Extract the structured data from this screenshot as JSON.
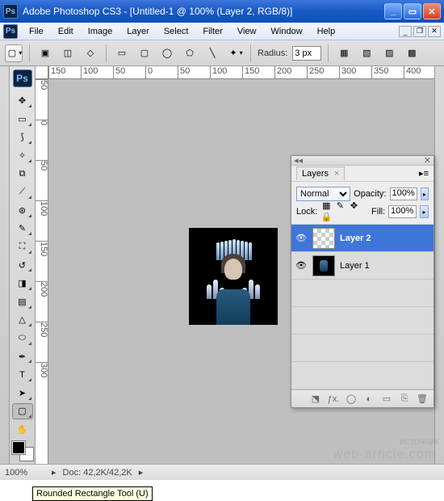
{
  "app": {
    "title": "Adobe Photoshop CS3 - [Untitled-1 @ 100% (Layer 2, RGB/8)]",
    "ps": "Ps"
  },
  "menu": {
    "file": "File",
    "edit": "Edit",
    "image": "Image",
    "layer": "Layer",
    "select": "Select",
    "filter": "Filter",
    "view": "View",
    "window": "Window",
    "help": "Help"
  },
  "options": {
    "radius_label": "Radius:",
    "radius_value": "3 px"
  },
  "ruler_h": [
    "150",
    "100",
    "50",
    "0",
    "50",
    "100",
    "150",
    "200",
    "250",
    "300",
    "350",
    "400"
  ],
  "ruler_v": [
    "5",
    "0",
    "0",
    "5",
    "0",
    "1",
    "0",
    "0",
    "1",
    "5",
    "0",
    "2",
    "0",
    "0",
    "2",
    "5",
    "0",
    "3",
    "0",
    "0"
  ],
  "layers_panel": {
    "title": "Layers",
    "blend": "Normal",
    "opacity_label": "Opacity:",
    "opacity": "100%",
    "lock_label": "Lock:",
    "fill_label": "Fill:",
    "fill": "100%",
    "layers": [
      {
        "name": "Layer 2",
        "selected": true,
        "thumb": "checker"
      },
      {
        "name": "Layer 1",
        "selected": false,
        "thumb": "dark"
      }
    ],
    "bottom_icons": [
      "⬔",
      "ƒx.",
      "◯",
      "◐",
      "▭",
      "⎘",
      "🗑"
    ]
  },
  "tooltip": "Rounded Rectangle Tool (U)",
  "status": {
    "zoom": "100%",
    "doc": "Doc: 42,2K/42,2K"
  },
  "watermark": "web-article.com",
  "srcword": "ИСТОЧНИК"
}
